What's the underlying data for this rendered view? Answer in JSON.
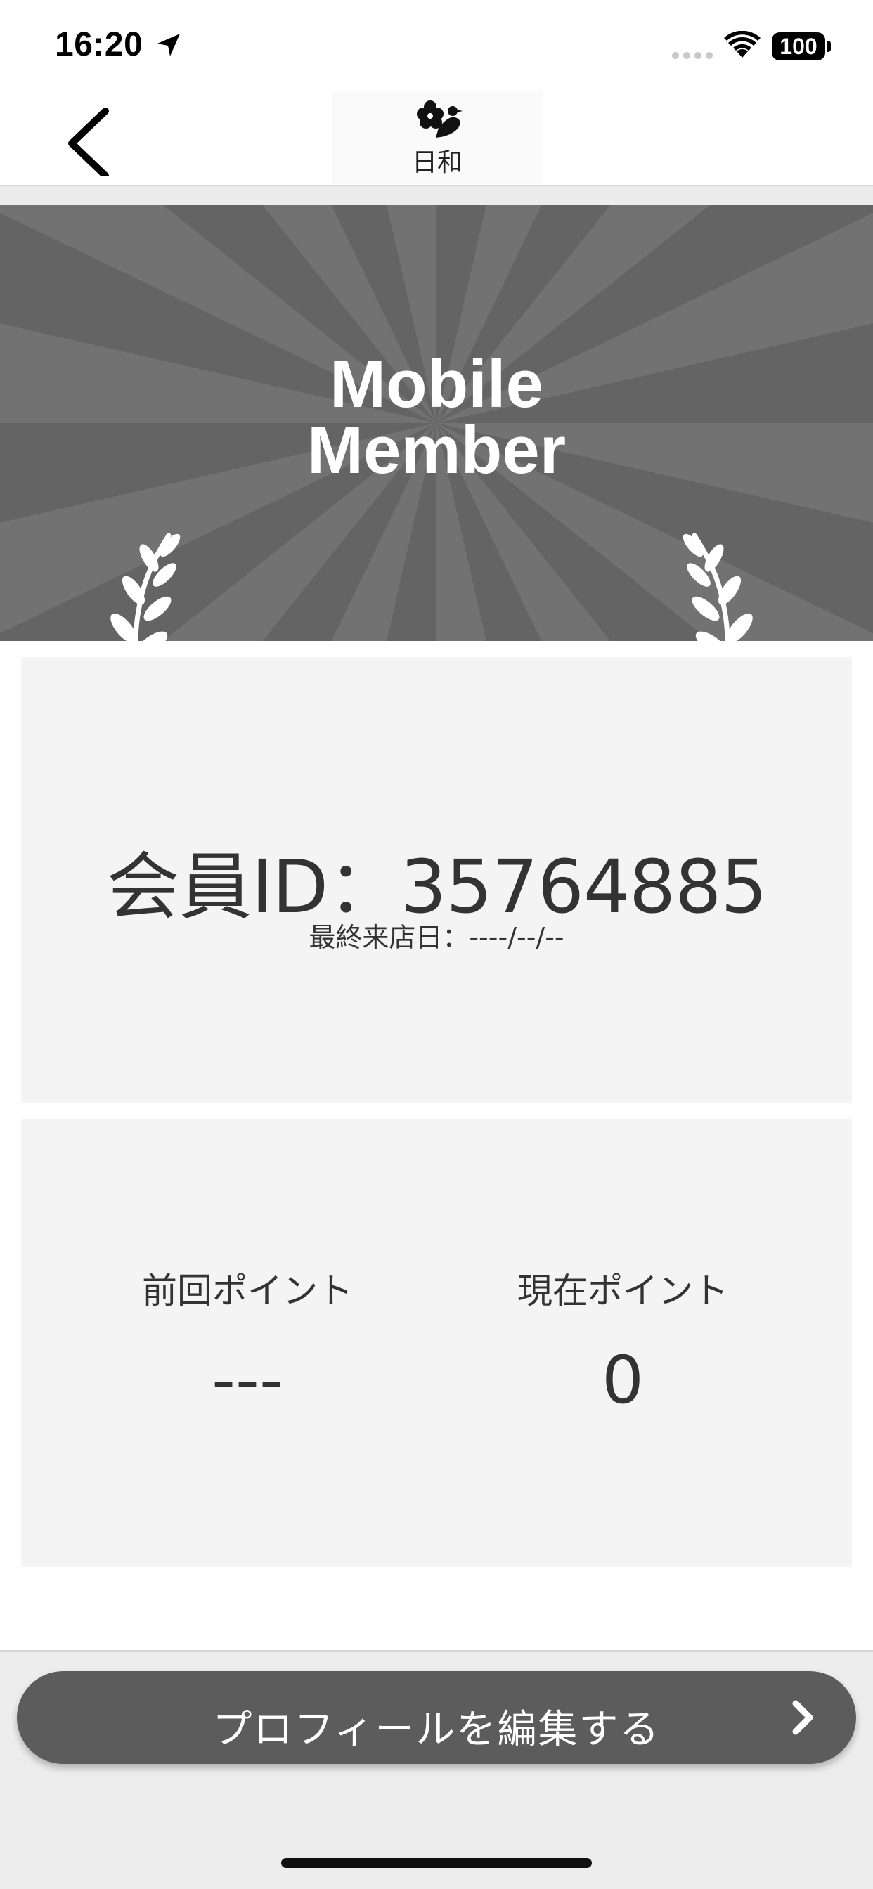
{
  "status_bar": {
    "time": "16:20",
    "battery": "100"
  },
  "header": {
    "logo_text": "日和",
    "back_icon": "chevron-left-icon"
  },
  "banner": {
    "title_line1": "Mobile",
    "title_line2": "Member",
    "background_color": "#646464",
    "ray_color": "#727272"
  },
  "member_card": {
    "member_id": "会員ID：35764885",
    "last_visit": "最終来店日：----/--/--"
  },
  "points_card": {
    "previous_label": "前回ポイント",
    "previous_value": "---",
    "current_label": "現在ポイント",
    "current_value": "0"
  },
  "footer": {
    "edit_profile_label": "プロフィールを編集する",
    "button_color": "#5c5c5c"
  }
}
